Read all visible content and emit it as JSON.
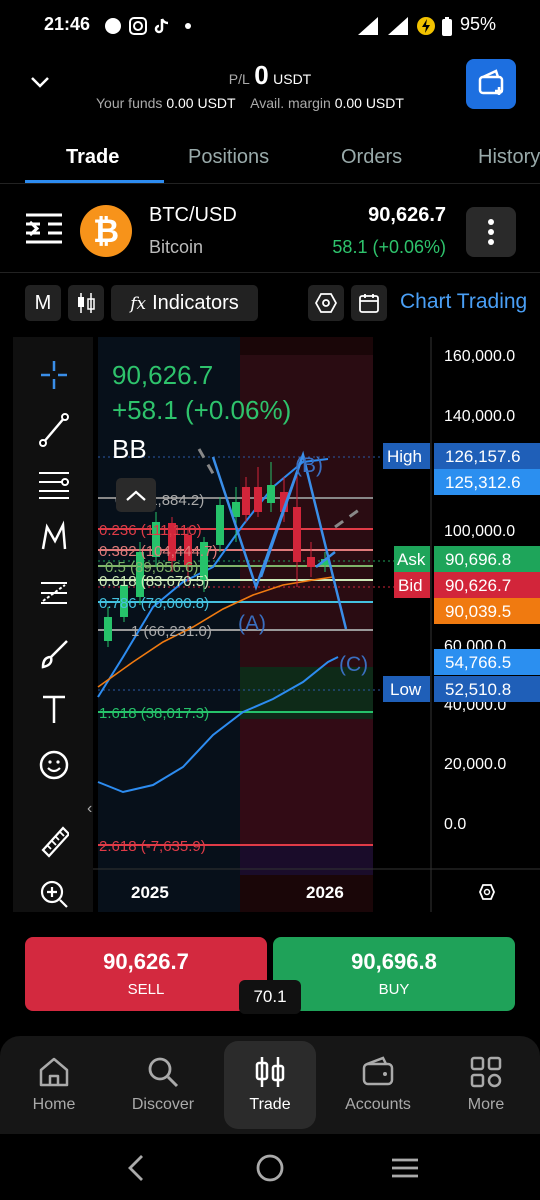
{
  "status": {
    "time": "21:46",
    "battery": "95%"
  },
  "header": {
    "pl_label": "P/L",
    "pl_value": "0",
    "pl_currency": "USDT",
    "funds_label": "Your funds",
    "funds_value": "0.00 USDT",
    "margin_label": "Avail. margin",
    "margin_value": "0.00 USDT"
  },
  "tabs": [
    {
      "label": "Trade",
      "active": true
    },
    {
      "label": "Positions",
      "active": false
    },
    {
      "label": "Orders",
      "active": false
    },
    {
      "label": "History",
      "active": false
    }
  ],
  "instrument": {
    "symbol": "BTC/USD",
    "name": "Bitcoin",
    "coin_glyph": "₿",
    "price": "90,626.7",
    "change": "58.1 (+0.06%)",
    "change_color": "#2ec36c"
  },
  "toolbar": {
    "interval": "M",
    "indicators_label": "Indicators",
    "chart_trading_label": "Chart Trading"
  },
  "chart_overlay": {
    "price": "90,626.7",
    "change": "+58.1 (+0.06%)",
    "indicator": "BB"
  },
  "chart_data": {
    "type": "candlestick",
    "y_ticks": [
      "160,000.0",
      "140,000.0",
      "100,000.0",
      "60,000.0",
      "40,000.0",
      "20,000.0",
      "0.0"
    ],
    "x_ticks": [
      "2025",
      "2026"
    ],
    "price_tags": [
      {
        "label": "High",
        "value": "126,157.6",
        "color": "#1f5fb8"
      },
      {
        "label": "",
        "value": "125,312.6",
        "color": "#2b8ff0"
      },
      {
        "label": "Ask",
        "value": "90,696.8",
        "color": "#1ea55a"
      },
      {
        "label": "Bid",
        "value": "90,626.7",
        "color": "#d2253a"
      },
      {
        "label": "",
        "value": "90,039.5",
        "color": "#f07a10"
      },
      {
        "label": "",
        "value": "54,766.5",
        "color": "#2b8ff0"
      },
      {
        "label": "Low",
        "value": "52,510.8",
        "color": "#1f5fb8"
      }
    ],
    "fib_labels": [
      "0 (121,884.2)",
      "0.236 (111,110)",
      "0.382 (104,444.7)",
      "0.5 (89,056.6)",
      "0.618 (83,670.5)",
      "0.786 (76,000.8)",
      "1 (66,231.0)",
      "1.618 (38,017.3)",
      "2.618 (-7,635.9)"
    ],
    "wave_labels": [
      "(A)",
      "(B)",
      "(C)"
    ]
  },
  "trade": {
    "sell_price": "90,626.7",
    "sell_label": "SELL",
    "buy_price": "90,696.8",
    "buy_label": "BUY",
    "spread": "70.1",
    "sell_color": "#d3293f",
    "buy_color": "#1fa259"
  },
  "nav": [
    {
      "label": "Home",
      "icon": "home-icon"
    },
    {
      "label": "Discover",
      "icon": "search-icon"
    },
    {
      "label": "Trade",
      "icon": "candles-icon"
    },
    {
      "label": "Accounts",
      "icon": "wallet-icon"
    },
    {
      "label": "More",
      "icon": "grid-icon"
    }
  ]
}
